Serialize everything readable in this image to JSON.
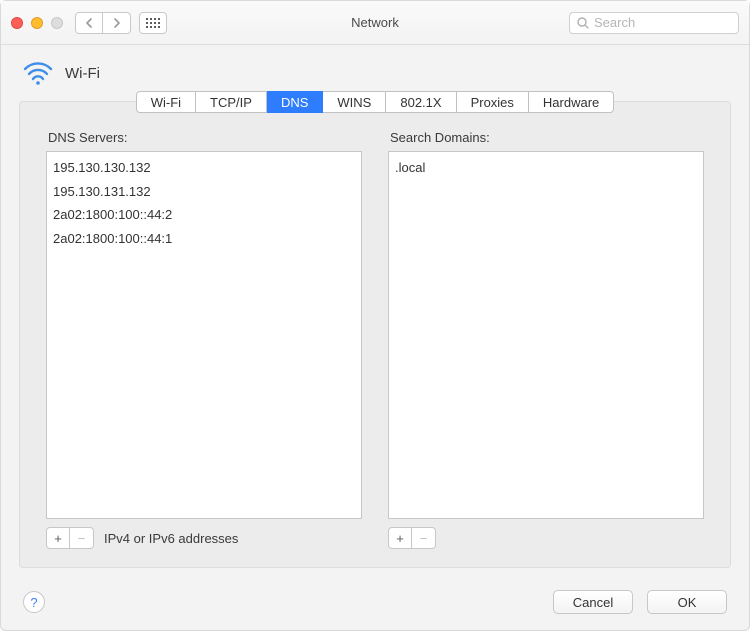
{
  "window": {
    "title": "Network"
  },
  "search": {
    "placeholder": "Search"
  },
  "header": {
    "wifi_label": "Wi-Fi"
  },
  "tabs": [
    {
      "label": "Wi-Fi",
      "active": false
    },
    {
      "label": "TCP/IP",
      "active": false
    },
    {
      "label": "DNS",
      "active": true
    },
    {
      "label": "WINS",
      "active": false
    },
    {
      "label": "802.1X",
      "active": false
    },
    {
      "label": "Proxies",
      "active": false
    },
    {
      "label": "Hardware",
      "active": false
    }
  ],
  "dns_panel": {
    "servers_label": "DNS Servers:",
    "servers": [
      "195.130.130.132",
      "195.130.131.132",
      "2a02:1800:100::44:2",
      "2a02:1800:100::44:1"
    ],
    "servers_hint": "IPv4 or IPv6 addresses",
    "domains_label": "Search Domains:",
    "domains": [
      ".local"
    ]
  },
  "buttons": {
    "plus": "+",
    "minus": "−",
    "help": "?",
    "cancel": "Cancel",
    "ok": "OK"
  }
}
